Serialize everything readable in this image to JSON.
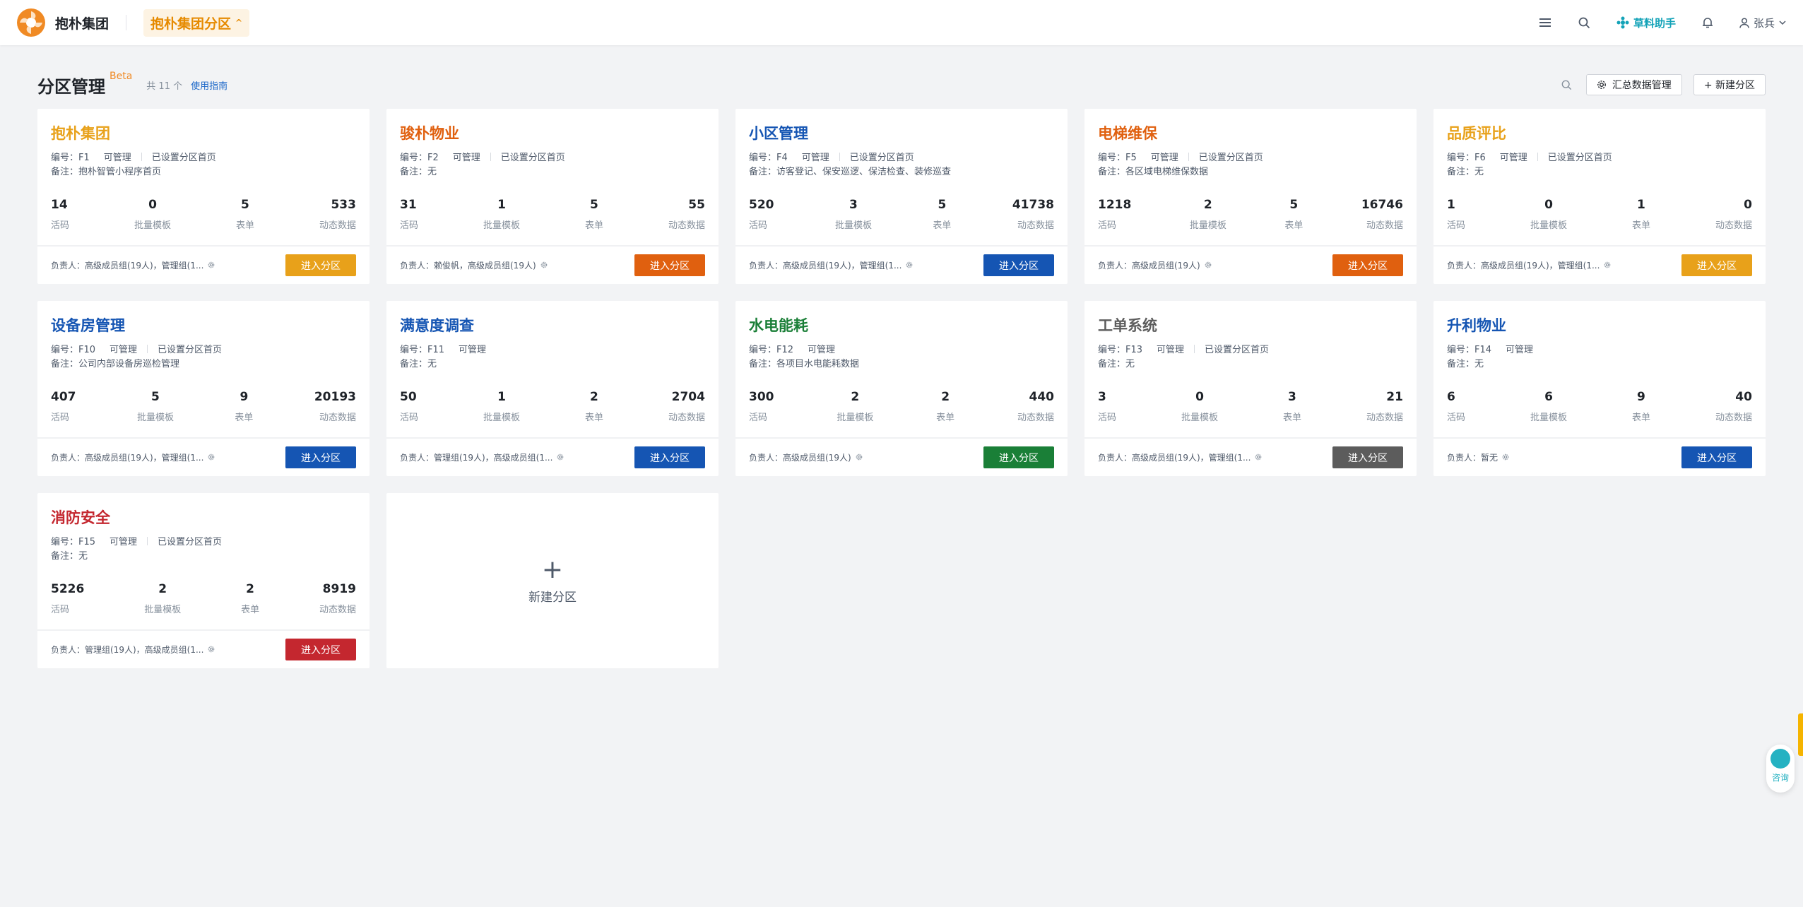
{
  "app": {
    "brand": "抱朴集团",
    "group_switch": "抱朴集团分区",
    "assistant": "草料助手",
    "user": "张兵"
  },
  "page": {
    "title": "分区管理",
    "beta": "Beta",
    "total": "共 11 个",
    "guide": "使用指南",
    "summary_button": "汇总数据管理",
    "new_button": "+  新建分区"
  },
  "labels": {
    "stat1": "活码",
    "stat2": "批量模板",
    "stat3": "表单",
    "stat4": "动态数据",
    "enter": "进入分区",
    "new_partition": "新建分区",
    "consult": "咨询"
  },
  "colors": {
    "orange_gold": "#e8a11a",
    "orange": "#e0600f",
    "blue": "#1555b3",
    "green": "#1a7f37",
    "gray": "#5c5c5c",
    "red": "#c4272f"
  },
  "cards": [
    {
      "title": "抱朴集团",
      "title_color": "#e8a11a",
      "code": "编号：F1",
      "manage": "可管理",
      "home": "已设置分区首页",
      "note": "备注：抱朴智管小程序首页",
      "s1": "14",
      "s2": "0",
      "s3": "5",
      "s4": "533",
      "owner": "负责人：高级成员组(19人)，管理组(1...",
      "btn_color": "#e8a11a"
    },
    {
      "title": "骏朴物业",
      "title_color": "#e0600f",
      "code": "编号：F2",
      "manage": "可管理",
      "home": "已设置分区首页",
      "note": "备注：无",
      "s1": "31",
      "s2": "1",
      "s3": "5",
      "s4": "55",
      "owner": "负责人：赖俊帆，高级成员组(19人)",
      "btn_color": "#e0600f"
    },
    {
      "title": "小区管理",
      "title_color": "#1555b3",
      "code": "编号：F4",
      "manage": "可管理",
      "home": "已设置分区首页",
      "note": "备注：访客登记、保安巡逻、保洁检查、装修巡查",
      "s1": "520",
      "s2": "3",
      "s3": "5",
      "s4": "41738",
      "owner": "负责人：高级成员组(19人)，管理组(1...",
      "btn_color": "#1555b3"
    },
    {
      "title": "电梯维保",
      "title_color": "#e0600f",
      "code": "编号：F5",
      "manage": "可管理",
      "home": "已设置分区首页",
      "note": "备注：各区域电梯维保数据",
      "s1": "1218",
      "s2": "2",
      "s3": "5",
      "s4": "16746",
      "owner": "负责人：高级成员组(19人)",
      "btn_color": "#e0600f"
    },
    {
      "title": "品质评比",
      "title_color": "#e8a11a",
      "code": "编号：F6",
      "manage": "可管理",
      "home": "已设置分区首页",
      "note": "备注：无",
      "s1": "1",
      "s2": "0",
      "s3": "1",
      "s4": "0",
      "owner": "负责人：高级成员组(19人)，管理组(1...",
      "btn_color": "#e8a11a"
    },
    {
      "title": "设备房管理",
      "title_color": "#1555b3",
      "code": "编号：F10",
      "manage": "可管理",
      "home": "已设置分区首页",
      "note": "备注：公司内部设备房巡检管理",
      "s1": "407",
      "s2": "5",
      "s3": "9",
      "s4": "20193",
      "owner": "负责人：高级成员组(19人)，管理组(1...",
      "btn_color": "#1555b3"
    },
    {
      "title": "满意度调查",
      "title_color": "#1555b3",
      "code": "编号：F11",
      "manage": "可管理",
      "home": "",
      "note": "备注：无",
      "s1": "50",
      "s2": "1",
      "s3": "2",
      "s4": "2704",
      "owner": "负责人：管理组(19人)，高级成员组(1...",
      "btn_color": "#1555b3"
    },
    {
      "title": "水电能耗",
      "title_color": "#1a7f37",
      "code": "编号：F12",
      "manage": "可管理",
      "home": "",
      "note": "备注：各项目水电能耗数据",
      "s1": "300",
      "s2": "2",
      "s3": "2",
      "s4": "440",
      "owner": "负责人：高级成员组(19人)",
      "btn_color": "#1a7f37"
    },
    {
      "title": "工单系统",
      "title_color": "#5c5c5c",
      "code": "编号：F13",
      "manage": "可管理",
      "home": "已设置分区首页",
      "note": "备注：无",
      "s1": "3",
      "s2": "0",
      "s3": "3",
      "s4": "21",
      "owner": "负责人：高级成员组(19人)，管理组(1...",
      "btn_color": "#5c5c5c"
    },
    {
      "title": "升利物业",
      "title_color": "#1555b3",
      "code": "编号：F14",
      "manage": "可管理",
      "home": "",
      "note": "备注：无",
      "s1": "6",
      "s2": "6",
      "s3": "9",
      "s4": "40",
      "owner": "负责人：暂无",
      "btn_color": "#1555b3"
    },
    {
      "title": "消防安全",
      "title_color": "#c4272f",
      "code": "编号：F15",
      "manage": "可管理",
      "home": "已设置分区首页",
      "note": "备注：无",
      "s1": "5226",
      "s2": "2",
      "s3": "2",
      "s4": "8919",
      "owner": "负责人：管理组(19人)，高级成员组(1...",
      "btn_color": "#c4272f"
    }
  ]
}
